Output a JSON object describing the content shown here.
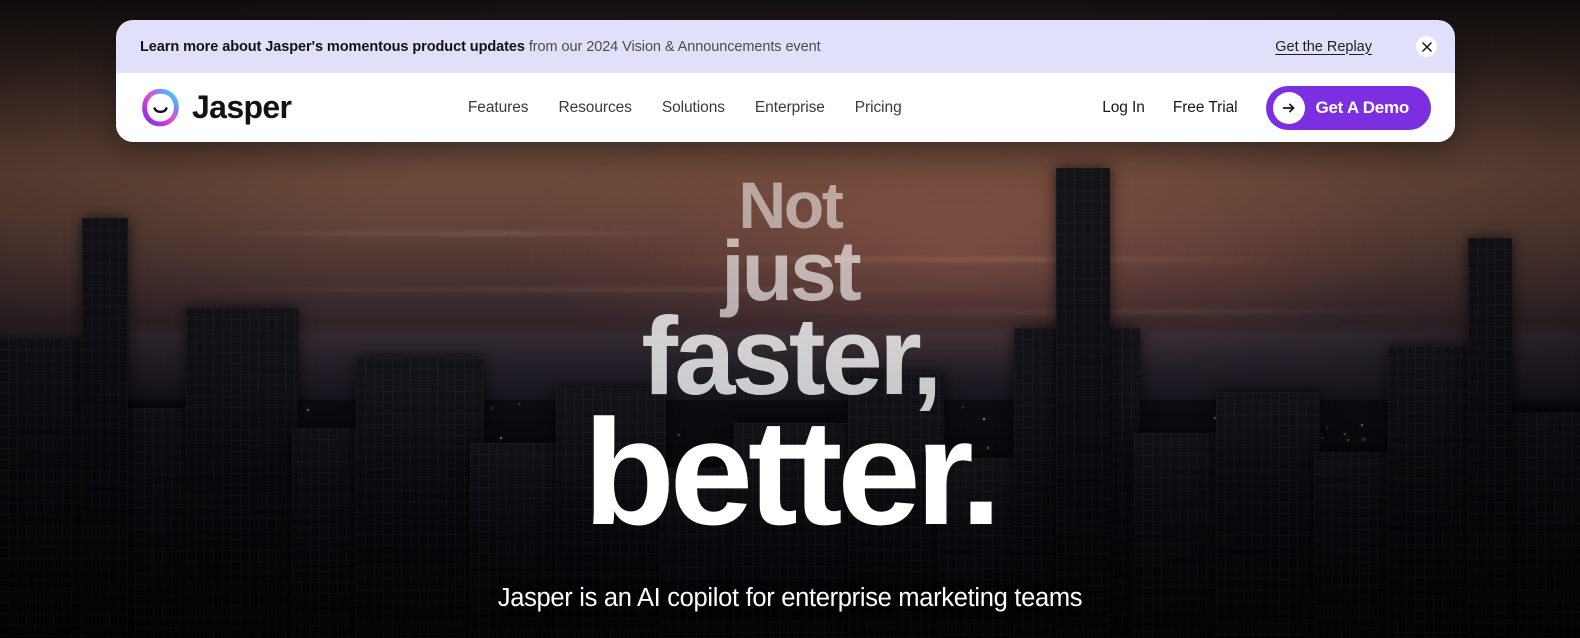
{
  "banner": {
    "text_bold": "Learn more about Jasper's momentous product updates",
    "text_rest": " from our 2024 Vision & Announcements event",
    "link_label": "Get the Replay",
    "close_icon": "close-icon",
    "background_color": "#E0E0FB"
  },
  "nav": {
    "brand_name": "Jasper",
    "brand_icon": "jasper-smile-logo-icon",
    "links": [
      {
        "label": "Features"
      },
      {
        "label": "Resources"
      },
      {
        "label": "Solutions"
      },
      {
        "label": "Enterprise"
      },
      {
        "label": "Pricing"
      }
    ],
    "login_label": "Log In",
    "free_trial_label": "Free Trial",
    "cta_label": "Get A Demo",
    "cta_icon": "arrow-right-icon",
    "cta_color": "#7B2FE0"
  },
  "hero": {
    "line1": "Not",
    "line2": "just",
    "line3": "faster,",
    "line4": "better.",
    "subtitle_line1": "Jasper is an AI copilot for enterprise marketing teams"
  },
  "background": {
    "description": "aerial dusk cityscape photograph"
  }
}
